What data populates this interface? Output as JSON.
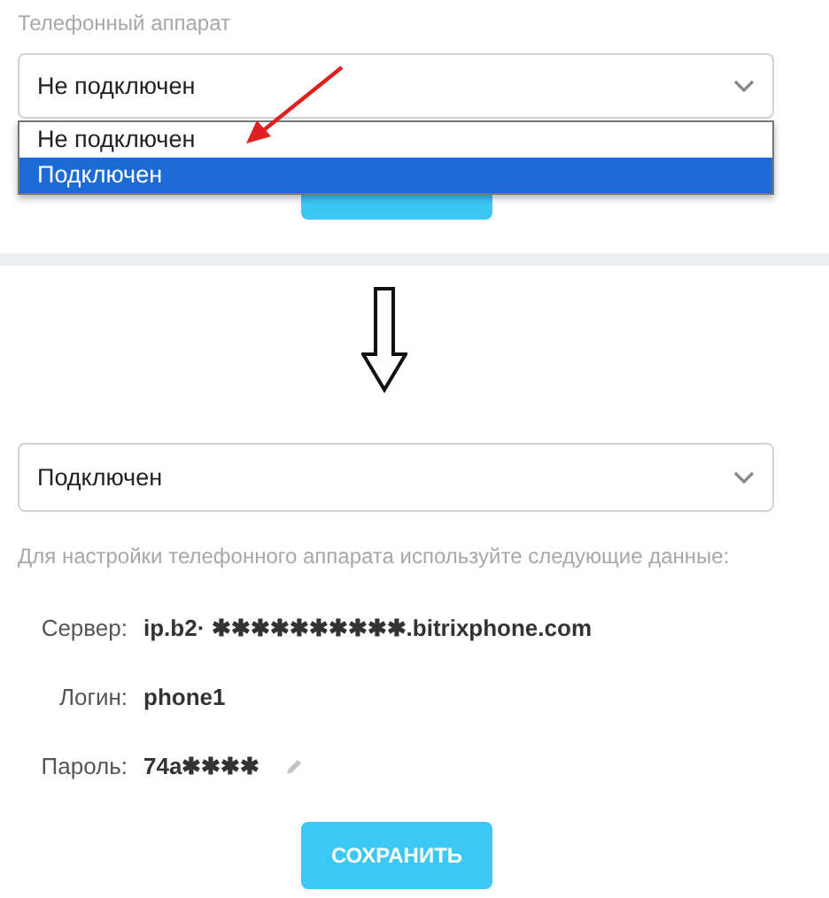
{
  "top": {
    "label": "Телефонный аппарат",
    "select": {
      "value": "Не подключен"
    },
    "options": [
      {
        "label": "Не подключен",
        "selected": false
      },
      {
        "label": "Подключен",
        "selected": true
      }
    ]
  },
  "bottom": {
    "select": {
      "value": "Подключен"
    },
    "hint": "Для настройки телефонного аппарата используйте следующие данные:",
    "fields": [
      {
        "label": "Сервер:",
        "value": "ip.b2· ✱✱✱✱✱✱✱✱✱✱.bitrixphone.com",
        "editable": false
      },
      {
        "label": "Логин:",
        "value": "phone1",
        "editable": false
      },
      {
        "label": "Пароль:",
        "value": "74a✱✱✱✱",
        "editable": true
      }
    ],
    "save_button": "СОХРАНИТЬ"
  }
}
